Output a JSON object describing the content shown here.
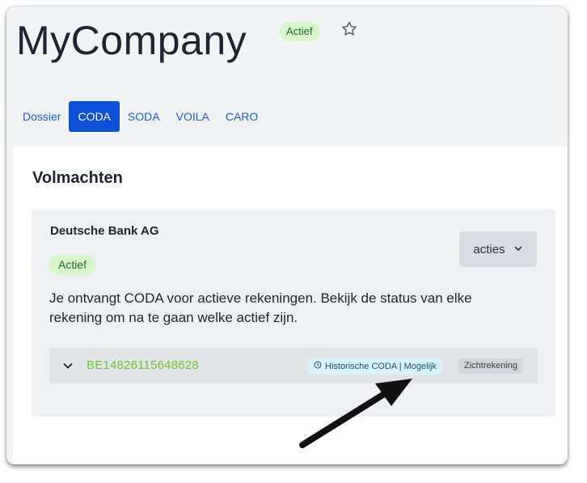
{
  "header": {
    "title": "MyCompany",
    "status_badge": "Actief"
  },
  "tabs": [
    {
      "label": "Dossier",
      "active": false
    },
    {
      "label": "CODA",
      "active": true
    },
    {
      "label": "SODA",
      "active": false
    },
    {
      "label": "VOILA",
      "active": false
    },
    {
      "label": "CARO",
      "active": false
    }
  ],
  "section": {
    "title": "Volmachten"
  },
  "mandate": {
    "bank_name": "Deutsche Bank AG",
    "status_badge": "Actief",
    "actions_label": "acties",
    "description": "Je ontvangt CODA voor actieve rekeningen. Bekijk de status van elke rekening om na te gaan welke actief zijn.",
    "account": {
      "iban": "BE14826115648628",
      "history_badge": "Historische CODA | Mogelijk",
      "type_badge": "Zichtrekening"
    }
  },
  "colors": {
    "accent": "#0d4fd7",
    "active_badge_bg": "#d9f7cf",
    "iban": "#6cc23a"
  },
  "icons": [
    "star-icon",
    "chevron-down-icon",
    "clock-icon",
    "annotation-arrow"
  ]
}
